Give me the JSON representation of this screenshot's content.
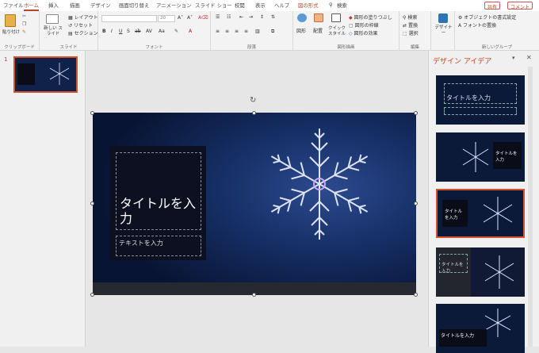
{
  "tabs": [
    "ファイル",
    "ホーム",
    "挿入",
    "描画",
    "デザイン",
    "画面切り替え",
    "アニメーション",
    "スライド ショー",
    "校閲",
    "表示",
    "ヘルプ",
    "図の形式"
  ],
  "search": "検索",
  "share": "共有",
  "comment": "コメント",
  "groups": {
    "clipboard": "クリップボード",
    "slides": "スライド",
    "font": "フォント",
    "paragraph": "段落",
    "drawing": "図形描画",
    "editing": "編集",
    "new_group": "新しいグループ"
  },
  "buttons": {
    "paste": "貼り付け",
    "new_slide": "新しい スライド",
    "layout": "レイアウト",
    "reset": "リセット",
    "section": "セクション",
    "shapes": "図形",
    "arrange": "配置",
    "quick_styles": "クイック スタイル",
    "fill": "図形の塗りつぶし",
    "outline": "図形の枠線",
    "effects": "図形の効果",
    "find": "検索",
    "replace": "置換",
    "select": "選択",
    "designer": "デザイナー",
    "object_format": "オブジェクトの書式設定",
    "replace_font": "フォントの置換"
  },
  "font_size": "20",
  "slide_number": "1",
  "slide": {
    "title": "タイトルを入力",
    "subtitle": "テキストを入力"
  },
  "design_pane": {
    "title": "デザイン アイデア",
    "designs": [
      "タイトルを入力",
      "タイトルを入力",
      "タイトルを入力",
      "タイトルを入力",
      "タイトルを入力"
    ]
  }
}
